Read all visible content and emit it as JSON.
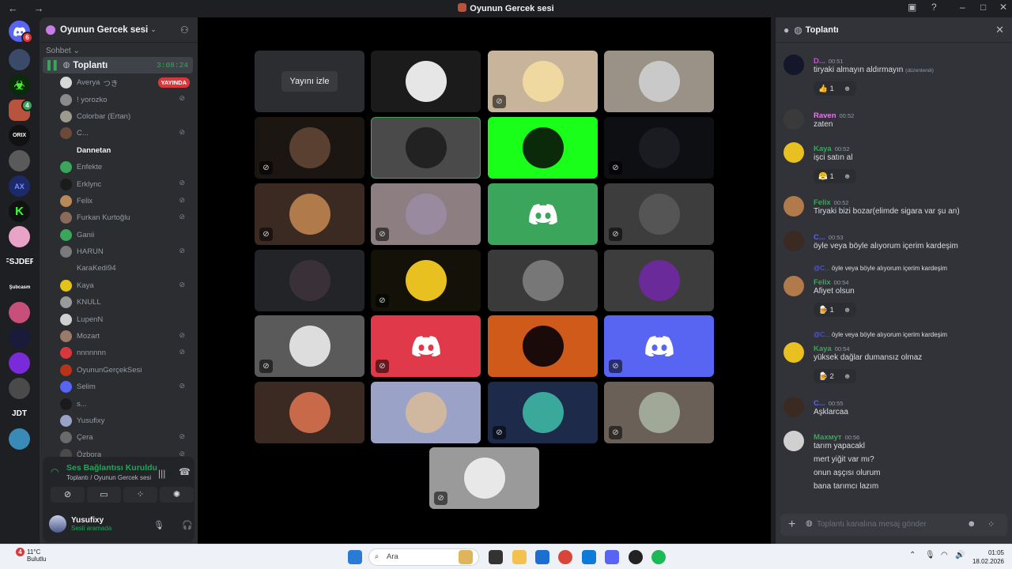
{
  "window": {
    "title": "Oyunun Gercek sesi",
    "nav": "← →"
  },
  "rail": {
    "badge_dm": "6",
    "badge_srv": "4",
    "fsjdep": "FSJDEP",
    "jdt": "JDT",
    "orix": "ORIX",
    "kaccam": "Şubcasm"
  },
  "sidebar": {
    "server_name": "Oyunun Gercek sesi",
    "category": "Sohbet",
    "voice_channel": "Toplantı",
    "voice_timer": "3:08:24",
    "users": [
      {
        "name": "Averya",
        "suffix": "つき",
        "live": "YAYINDA",
        "color": "#d7d7d7",
        "on": false,
        "muted": false
      },
      {
        "name": "! yorozko",
        "color": "#8a8a8a",
        "on": false,
        "muted": true
      },
      {
        "name": "Colorbar (Ertan)",
        "color": "#9e9a8e",
        "on": false,
        "muted": false
      },
      {
        "name": "C...",
        "color": "#6b4a3a",
        "on": false,
        "muted": true
      },
      {
        "name": "Dannetan",
        "color": "#2b2d31",
        "on": true,
        "muted": false
      },
      {
        "name": "Enfekte",
        "color": "#3ba55c",
        "on": false,
        "muted": false
      },
      {
        "name": "Erklync",
        "color": "#1b1b1b",
        "on": false,
        "muted": true
      },
      {
        "name": "Felix",
        "color": "#b88a5a",
        "on": false,
        "muted": true
      },
      {
        "name": "Furkan Kurtoğlu",
        "color": "#8a6a5a",
        "on": false,
        "muted": true
      },
      {
        "name": "Ganii",
        "color": "#3ba55c",
        "on": false,
        "muted": false
      },
      {
        "name": "HARUN",
        "color": "#7a7a7a",
        "on": false,
        "muted": true
      },
      {
        "name": "KaraKedi94",
        "color": "#2e2e2e",
        "on": false,
        "muted": false
      },
      {
        "name": "Kaya",
        "color": "#e3c21a",
        "on": false,
        "muted": true
      },
      {
        "name": "KNULL",
        "color": "#9a9a9a",
        "on": false,
        "muted": false
      },
      {
        "name": "LupenN",
        "color": "#d0d0d0",
        "on": false,
        "muted": false
      },
      {
        "name": "Mozart",
        "color": "#9a7a6a",
        "on": false,
        "muted": true
      },
      {
        "name": "nnnnnnn",
        "color": "#da373c",
        "on": false,
        "muted": true
      },
      {
        "name": "OyununGerçekSesi",
        "color": "#b8331a",
        "on": false,
        "muted": false
      },
      {
        "name": "Selim",
        "color": "#5865f2",
        "on": false,
        "muted": true
      },
      {
        "name": "s...",
        "color": "#1b1b1b",
        "on": false,
        "muted": false
      },
      {
        "name": "Yusufixy",
        "color": "#9aa2c8",
        "on": false,
        "muted": false
      },
      {
        "name": "Çera",
        "color": "#6a6a6a",
        "on": false,
        "muted": true
      },
      {
        "name": "Özbora",
        "color": "#4a4a4a",
        "on": false,
        "muted": true
      }
    ],
    "voice_status": "Ses Bağlantısı Kuruldu",
    "voice_sub": "Toplantı / Oyunun Gercek sesi",
    "user_name": "Yusufixy",
    "user_status": "Sesli aramada"
  },
  "stage": {
    "watch_label": "Yayını izle"
  },
  "chat": {
    "channel": "Toplantı",
    "messages": [
      {
        "author": "D...",
        "time": "00:51",
        "text": "tiryaki almayın aldırmayın",
        "edited": "(düzenlendi)",
        "reaction": "👍",
        "count": "1",
        "color": "#c84fd8"
      },
      {
        "author": "Raven",
        "time": "00:52",
        "text": "zaten",
        "color": "#e879e8"
      },
      {
        "author": "Kaya",
        "time": "00:52",
        "text": "işci satın al",
        "reaction": "😤",
        "count": "1",
        "color": "#3ba55c"
      },
      {
        "author": "Felix",
        "time": "00:52",
        "text": "Tiryaki bizi bozar(elimde sigara var şu an)",
        "color": "#3ba55c"
      },
      {
        "author": "C...",
        "time": "00:53",
        "text": "öyle veya böyle alıyorum içerim kardeşim",
        "color": "#5865f2"
      },
      {
        "reply": "öyle veya böyle alıyorum içerim kardeşim",
        "reply_name": "@C...",
        "author": "Felix",
        "time": "00:54",
        "text": "Afiyet olsun",
        "reaction": "🍺",
        "count": "1",
        "color": "#3ba55c"
      },
      {
        "reply": "öyle veya böyle alıyorum içerim kardeşim",
        "reply_name": "@C...",
        "author": "Kaya",
        "time": "00:54",
        "text": "yüksek dağlar dumansız olmaz",
        "reaction": "🍺",
        "count": "2",
        "color": "#3ba55c"
      },
      {
        "author": "C...",
        "time": "00:55",
        "text": "Aşklarcaa",
        "color": "#5865f2"
      },
      {
        "author": "Махмут",
        "time": "00:56",
        "lines": [
          "tarım yapacakl",
          "mert yiğit var mı?",
          "onun aşçısı olurum",
          "bana tarımcı lazım"
        ],
        "color": "#3ba55c"
      }
    ],
    "placeholder": "Toplantı kanalına mesaj gönder"
  },
  "taskbar": {
    "temp": "11°C",
    "weather": "Bulutlu",
    "weather_badge": "4",
    "search": "Ara",
    "time": "01:05",
    "date": "18.02.2026"
  }
}
